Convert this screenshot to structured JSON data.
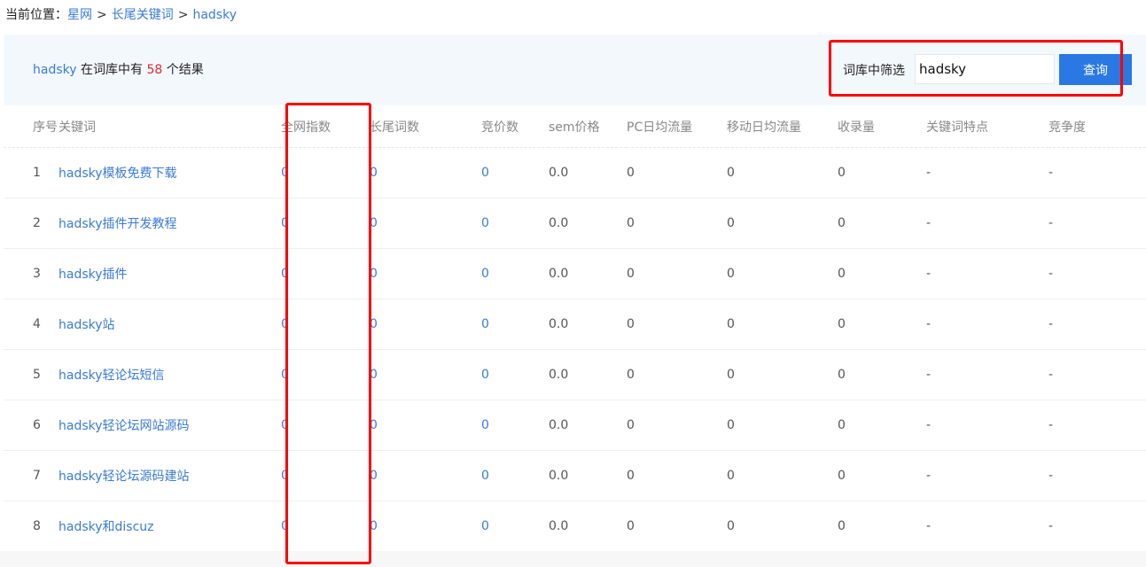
{
  "breadcrumb": {
    "prefix": "当前位置：",
    "items": [
      "星网",
      "长尾关键词",
      "hadsky"
    ],
    "separator": ">"
  },
  "summary": {
    "keyword": "hadsky",
    "text_middle": "在词库中有",
    "count": "58",
    "text_end": "个结果"
  },
  "filter": {
    "label": "词库中筛选",
    "value": "hadsky",
    "button_label": "查询"
  },
  "table": {
    "columns": [
      "序号",
      "关键词",
      "全网指数",
      "长尾词数",
      "竞价数",
      "sem价格",
      "PC日均流量",
      "移动日均流量",
      "收录量",
      "关键词特点",
      "竞争度"
    ],
    "rows": [
      [
        "1",
        "hadsky模板免费下载",
        "0",
        "0",
        "0",
        "0.0",
        "0",
        "0",
        "0",
        "-",
        "-"
      ],
      [
        "2",
        "hadsky插件开发教程",
        "0",
        "0",
        "0",
        "0.0",
        "0",
        "0",
        "0",
        "-",
        "-"
      ],
      [
        "3",
        "hadsky插件",
        "0",
        "0",
        "0",
        "0.0",
        "0",
        "0",
        "0",
        "-",
        "-"
      ],
      [
        "4",
        "hadsky站",
        "0",
        "0",
        "0",
        "0.0",
        "0",
        "0",
        "0",
        "-",
        "-"
      ],
      [
        "5",
        "hadsky轻论坛短信",
        "0",
        "0",
        "0",
        "0.0",
        "0",
        "0",
        "0",
        "-",
        "-"
      ],
      [
        "6",
        "hadsky轻论坛网站源码",
        "0",
        "0",
        "0",
        "0.0",
        "0",
        "0",
        "0",
        "-",
        "-"
      ],
      [
        "7",
        "hadsky轻论坛源码建站",
        "0",
        "0",
        "0",
        "0.0",
        "0",
        "0",
        "0",
        "-",
        "-"
      ],
      [
        "8",
        "hadsky和discuz",
        "0",
        "0",
        "0",
        "0.0",
        "0",
        "0",
        "0",
        "-",
        "-"
      ]
    ]
  },
  "colors": {
    "link": "#3a7bd5",
    "count": "#e12b2b",
    "button": "#2a78e4",
    "highlight": "#ff0000",
    "summary_bg": "#f3f8fc"
  }
}
